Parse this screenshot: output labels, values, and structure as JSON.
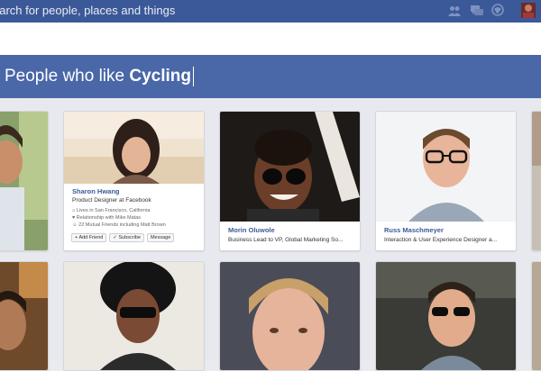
{
  "header": {
    "search_placeholder": "earch for people, places and things",
    "icons": [
      "friend-requests-icon",
      "messages-icon",
      "notifications-icon",
      "profile-avatar-icon"
    ]
  },
  "search_bar": {
    "query_prefix": "People who like ",
    "query_term": "Cycling"
  },
  "people": [
    {
      "name": "Sharon Hwang",
      "title": "Product Designer at Facebook",
      "lives": "Lives in San Francisco, California",
      "relationship": "Relationship with Mike Matas",
      "mutual": "22 Mutual Friends including Matt Brown",
      "buttons": [
        "Add Friend",
        "Subscribe",
        "Message"
      ]
    },
    {
      "name": "Morin Oluwole",
      "title": "Business Lead to VP, Global Marketing So..."
    },
    {
      "name": "Russ Maschmeyer",
      "title": "Interaction & User Experience Designer a..."
    }
  ],
  "colors": {
    "top_bar": "#3b5998",
    "query_bar": "#4a67a8",
    "link_blue": "#3b5998",
    "grid_bg": "#e7e9ee"
  }
}
